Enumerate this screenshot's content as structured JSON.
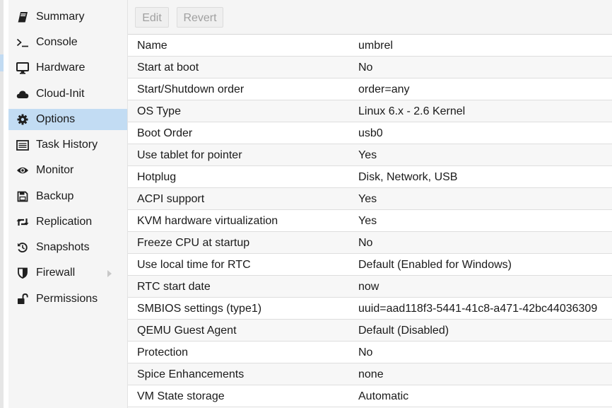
{
  "sidebar": {
    "items": [
      {
        "label": "Summary",
        "icon": "book-icon"
      },
      {
        "label": "Console",
        "icon": "terminal-icon"
      },
      {
        "label": "Hardware",
        "icon": "monitor-icon"
      },
      {
        "label": "Cloud-Init",
        "icon": "cloud-icon"
      },
      {
        "label": "Options",
        "icon": "gear-icon",
        "selected": true
      },
      {
        "label": "Task History",
        "icon": "list-icon"
      },
      {
        "label": "Monitor",
        "icon": "eye-icon"
      },
      {
        "label": "Backup",
        "icon": "floppy-icon"
      },
      {
        "label": "Replication",
        "icon": "retweet-icon"
      },
      {
        "label": "Snapshots",
        "icon": "history-icon"
      },
      {
        "label": "Firewall",
        "icon": "shield-icon",
        "has_submenu": true
      },
      {
        "label": "Permissions",
        "icon": "unlock-icon"
      }
    ]
  },
  "toolbar": {
    "edit_label": "Edit",
    "revert_label": "Revert"
  },
  "options": [
    {
      "name": "Name",
      "value": "umbrel"
    },
    {
      "name": "Start at boot",
      "value": "No"
    },
    {
      "name": "Start/Shutdown order",
      "value": "order=any"
    },
    {
      "name": "OS Type",
      "value": "Linux 6.x - 2.6 Kernel"
    },
    {
      "name": "Boot Order",
      "value": "usb0"
    },
    {
      "name": "Use tablet for pointer",
      "value": "Yes"
    },
    {
      "name": "Hotplug",
      "value": "Disk, Network, USB"
    },
    {
      "name": "ACPI support",
      "value": "Yes"
    },
    {
      "name": "KVM hardware virtualization",
      "value": "Yes"
    },
    {
      "name": "Freeze CPU at startup",
      "value": "No"
    },
    {
      "name": "Use local time for RTC",
      "value": "Default (Enabled for Windows)"
    },
    {
      "name": "RTC start date",
      "value": "now"
    },
    {
      "name": "SMBIOS settings (type1)",
      "value": "uuid=aad118f3-5441-41c8-a471-42bc44036309"
    },
    {
      "name": "QEMU Guest Agent",
      "value": "Default (Disabled)"
    },
    {
      "name": "Protection",
      "value": "No"
    },
    {
      "name": "Spice Enhancements",
      "value": "none"
    },
    {
      "name": "VM State storage",
      "value": "Automatic"
    }
  ],
  "colors": {
    "selected_bg": "#c2dcf3",
    "sidebar_bg": "#f5f5f5",
    "icon": "#1f1f1f"
  }
}
